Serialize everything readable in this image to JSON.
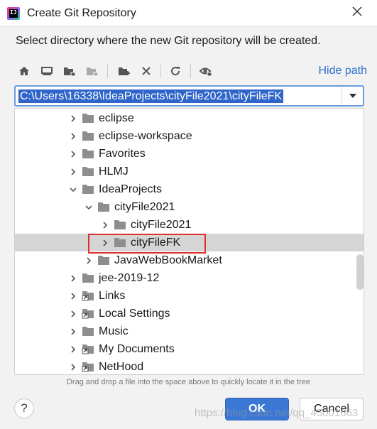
{
  "window": {
    "title": "Create Git Repository",
    "app_icon_letters": "IJ",
    "close_icon": "close-icon"
  },
  "description": "Select directory where the new Git repository will be created.",
  "toolbar": {
    "buttons": [
      {
        "name": "home-icon"
      },
      {
        "name": "desktop-icon"
      },
      {
        "name": "project-folder-icon"
      },
      {
        "name": "module-folder-icon"
      },
      {
        "name": "new-folder-icon"
      },
      {
        "name": "delete-icon"
      },
      {
        "name": "refresh-icon"
      },
      {
        "name": "show-hidden-icon"
      }
    ],
    "hide_path_label": "Hide path"
  },
  "path_field": {
    "value": "C:\\Users\\16338\\IdeaProjects\\cityFile2021\\cityFileFK"
  },
  "tree": {
    "rows": [
      {
        "label": "eclipse",
        "expanded": false,
        "icon": "folder-icon",
        "selected": false
      },
      {
        "label": "eclipse-workspace",
        "expanded": false,
        "icon": "folder-icon",
        "selected": false
      },
      {
        "label": "Favorites",
        "expanded": false,
        "icon": "folder-icon",
        "selected": false
      },
      {
        "label": "HLMJ",
        "expanded": false,
        "icon": "folder-icon",
        "selected": false
      },
      {
        "label": "IdeaProjects",
        "expanded": true,
        "icon": "folder-icon",
        "selected": false
      },
      {
        "label": "cityFile2021",
        "expanded": true,
        "icon": "folder-icon",
        "selected": false
      },
      {
        "label": "cityFile2021",
        "expanded": false,
        "icon": "folder-icon",
        "selected": false
      },
      {
        "label": "cityFileFK",
        "expanded": false,
        "icon": "folder-icon",
        "selected": true
      },
      {
        "label": "JavaWebBookMarket",
        "expanded": false,
        "icon": "folder-icon",
        "selected": false
      },
      {
        "label": "jee-2019-12",
        "expanded": false,
        "icon": "folder-icon",
        "selected": false
      },
      {
        "label": "Links",
        "expanded": false,
        "icon": "shortcut-folder-icon",
        "selected": false
      },
      {
        "label": "Local Settings",
        "expanded": false,
        "icon": "shortcut-folder-icon",
        "selected": false
      },
      {
        "label": "Music",
        "expanded": false,
        "icon": "folder-icon",
        "selected": false
      },
      {
        "label": "My Documents",
        "expanded": false,
        "icon": "shortcut-folder-icon",
        "selected": false
      },
      {
        "label": "NetHood",
        "expanded": false,
        "icon": "shortcut-folder-icon",
        "selected": false
      }
    ]
  },
  "hint": "Drag and drop a file into the space above to quickly locate it in the tree",
  "buttons": {
    "help_label": "?",
    "ok_label": "OK",
    "cancel_label": "Cancel"
  },
  "watermark": "https://blog.csdn.net/qq_45001663",
  "colors": {
    "accent": "#3b78d6",
    "link": "#2f6fd1",
    "selection_text_bg": "#2f65ca",
    "selected_row": "#d5d5d5",
    "highlight_box": "#e0302c"
  }
}
